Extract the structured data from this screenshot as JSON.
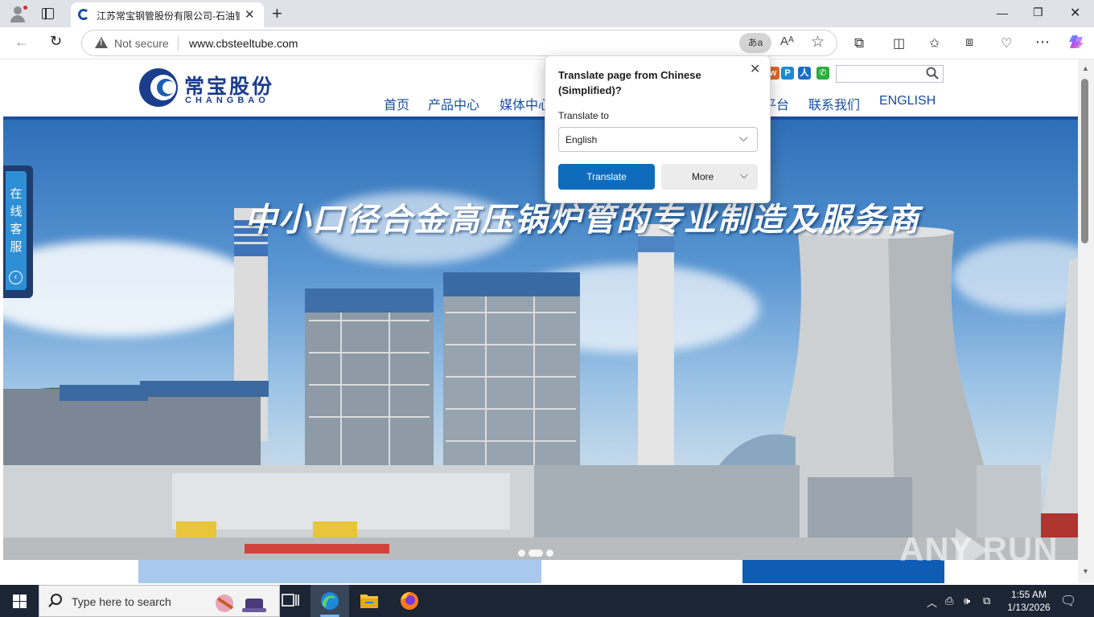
{
  "browser": {
    "tab": {
      "title": "江苏常宝钢管股份有限公司-石油管"
    },
    "address": {
      "security": "Not secure",
      "url": "www.cbsteeltube.com"
    },
    "translate_icon_text": "あa",
    "readaloud_text": "Aᴬ"
  },
  "site": {
    "logo": {
      "cn": "常宝股份",
      "en": "CHANGBAO"
    },
    "nav": [
      "首页",
      "产品中心",
      "媒体中心",
      "平台",
      "联系我们",
      "ENGLISH"
    ],
    "banner": {
      "slogan": "中小口径合金高压锅炉管的专业制造及服务商"
    },
    "service": {
      "label": "在线客服",
      "arrow": "‹"
    },
    "colors": {
      "brand_blue": "#1b4f9c",
      "nav_blue": "#1a4ea0"
    }
  },
  "translate_popup": {
    "title": "Translate page from Chinese (Simplified)?",
    "label": "Translate to",
    "language": "English",
    "translate_button": "Translate",
    "more_button": "More"
  },
  "taskbar": {
    "search_placeholder": "Type here to search",
    "time": "1:55 AM",
    "date": "1/13/2026"
  },
  "watermark": "ANY RUN"
}
